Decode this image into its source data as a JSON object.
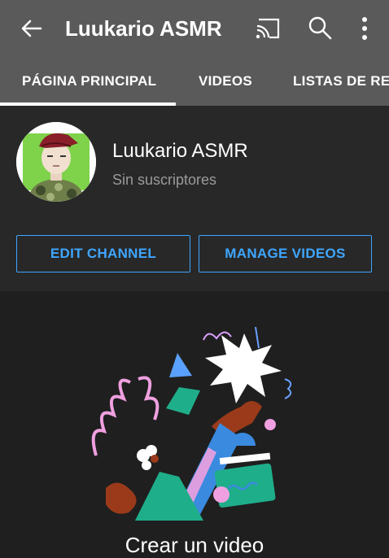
{
  "appbar": {
    "title": "Luukario ASMR",
    "icons": [
      "back-arrow-icon",
      "cast-icon",
      "search-icon",
      "more-vert-icon"
    ]
  },
  "tabs": [
    {
      "label": "PÁGINA PRINCIPAL",
      "active": true
    },
    {
      "label": "VIDEOS",
      "active": false
    },
    {
      "label": "LISTAS DE REPRODUCCIÓN",
      "active": false
    }
  ],
  "channel": {
    "name": "Luukario ASMR",
    "subscribers": "Sin suscriptores"
  },
  "buttons": {
    "edit": "EDIT CHANNEL",
    "manage": "MANAGE VIDEOS"
  },
  "empty_state": {
    "title": "Crear un video"
  },
  "colors": {
    "appbar": "#5a5a5a",
    "background": "#1f1f1f",
    "header": "#282828",
    "accent": "#3ea6ff"
  }
}
